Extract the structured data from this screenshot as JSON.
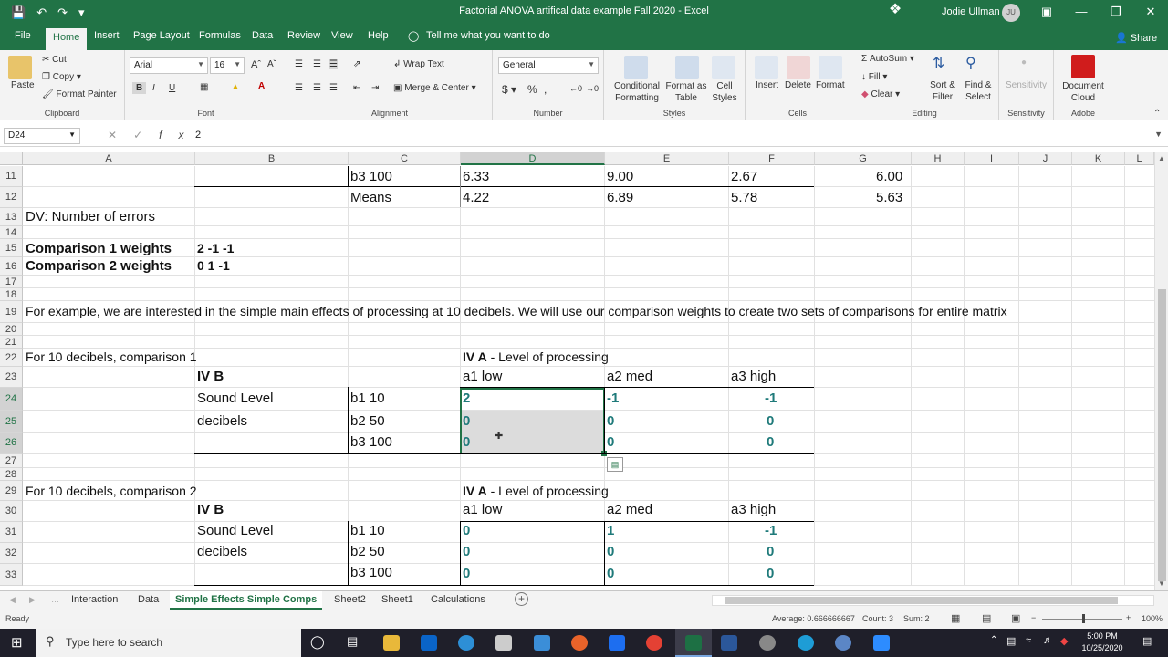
{
  "window": {
    "title": "Factorial ANOVA artifical data example Fall 2020  -  Excel",
    "user": "Jodie Ullman",
    "user_initials": "JU"
  },
  "ribbon_tabs": [
    "File",
    "Home",
    "Insert",
    "Page Layout",
    "Formulas",
    "Data",
    "Review",
    "View",
    "Help",
    "Tell me what you want to do"
  ],
  "share_label": "Share",
  "ribbon": {
    "clipboard": {
      "paste": "Paste",
      "cut": "Cut",
      "copy": "Copy",
      "format_painter": "Format Painter",
      "label": "Clipboard"
    },
    "font": {
      "name": "Arial",
      "size": "16",
      "label": "Font"
    },
    "alignment": {
      "wrap": "Wrap Text",
      "merge": "Merge & Center",
      "label": "Alignment"
    },
    "number": {
      "format": "General",
      "label": "Number"
    },
    "styles": {
      "conditional": "Conditional Formatting",
      "format_table": "Format as Table",
      "cell_styles": "Cell Styles",
      "label": "Styles"
    },
    "cells": {
      "insert": "Insert",
      "delete": "Delete",
      "format": "Format",
      "label": "Cells"
    },
    "editing": {
      "autosum": "AutoSum",
      "fill": "Fill",
      "clear": "Clear",
      "sort": "Sort & Filter",
      "find": "Find & Select",
      "label": "Editing"
    },
    "sensitivity": {
      "btn": "Sensitivity",
      "label": "Sensitivity"
    },
    "adobe": {
      "btn": "Document Cloud",
      "label": "Adobe"
    }
  },
  "formula_bar": {
    "name_box": "D24",
    "value": "2"
  },
  "columns": [
    "A",
    "B",
    "C",
    "D",
    "E",
    "F",
    "G",
    "H",
    "I",
    "J",
    "K",
    "L"
  ],
  "rows": [
    "11",
    "12",
    "13",
    "14",
    "15",
    "16",
    "17",
    "18",
    "19",
    "20",
    "21",
    "22",
    "23",
    "24",
    "25",
    "26",
    "27",
    "28",
    "29",
    "30",
    "31",
    "32",
    "33"
  ],
  "cells": {
    "r11": {
      "c": "b3 100",
      "d": "6.33",
      "e": "9.00",
      "f": "2.67",
      "g": "6.00"
    },
    "r12": {
      "c": "Means",
      "d": "4.22",
      "e": "6.89",
      "f": "5.78",
      "g": "5.63"
    },
    "r13": {
      "a": "DV: Number of errors"
    },
    "r15": {
      "a": "Comparison 1 weights",
      "b": "2 -1 -1"
    },
    "r16": {
      "a": "Comparison 2 weights",
      "b": "0 1 -1"
    },
    "r19": {
      "a": "For example, we are interested in the simple main effects of processing at 10 decibels.   We will use our comparison weights to create two sets of comparisons for entire matrix"
    },
    "r22": {
      "a": "For 10 decibels, comparison 1",
      "d_bold": "IV A",
      "d_rest": " - Level of processing"
    },
    "r23": {
      "b": "IV B",
      "d": "a1 low",
      "e": "a2 med",
      "f": "a3 high"
    },
    "r24": {
      "b": "Sound Level",
      "c": "b1 10",
      "d": "2",
      "e": "-1",
      "f": "-1"
    },
    "r25": {
      "b": "decibels",
      "c": "b2  50",
      "d": "0",
      "e": "0",
      "f": "0"
    },
    "r26": {
      "c": "b3 100",
      "d": "0",
      "e": "0",
      "f": "0"
    },
    "r29": {
      "a": "For 10 decibels, comparison 2",
      "d_bold": "IV A",
      "d_rest": " - Level of processing"
    },
    "r30": {
      "b": "IV B",
      "d": "a1 low",
      "e": "a2 med",
      "f": "a3 high"
    },
    "r31": {
      "b": "Sound Level",
      "c": "b1 10",
      "d": "0",
      "e": "1",
      "f": "-1"
    },
    "r32": {
      "b": "decibels",
      "c": "b2  50",
      "d": "0",
      "e": "0",
      "f": "0"
    },
    "r33": {
      "c": "b3 100",
      "d": "0",
      "e": "0",
      "f": "0"
    }
  },
  "sheet_tabs": [
    "Interaction",
    "Data",
    "Simple Effects Simple Comps",
    "Sheet2",
    "Sheet1",
    "Calculations"
  ],
  "active_sheet": "Simple Effects Simple Comps",
  "status": {
    "ready": "Ready",
    "average": "Average: 0.666666667",
    "count": "Count: 3",
    "sum": "Sum: 2",
    "zoom": "100%"
  },
  "taskbar": {
    "search": "Type here to search",
    "time": "5:00 PM",
    "date": "10/25/2020"
  },
  "colors": {
    "excel_green": "#217346",
    "teal_values": "#1f7a7a"
  }
}
